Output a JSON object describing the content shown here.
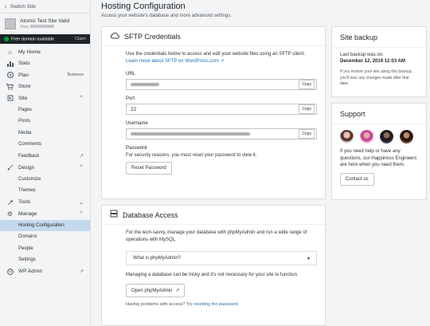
{
  "sidebar": {
    "switch_site": "Switch Site",
    "site_name": "Atomic Test Site Valid",
    "site_view": "View",
    "promo_text": "Free domain available",
    "promo_claim": "Claim",
    "items": {
      "my_home": "My Home",
      "stats": "Stats",
      "plan": "Plan",
      "plan_badge": "Business",
      "store": "Store",
      "site": "Site",
      "pages": "Pages",
      "posts": "Posts",
      "media": "Media",
      "comments": "Comments",
      "feedback": "Feedback",
      "design": "Design",
      "customize": "Customize",
      "themes": "Themes",
      "tools": "Tools",
      "manage": "Manage",
      "hosting": "Hosting Configuration",
      "domains": "Domains",
      "people": "People",
      "settings": "Settings",
      "wp_admin": "WP Admin"
    }
  },
  "header": {
    "title": "Hosting Configuration",
    "subtitle": "Access your website's database and more advanced settings."
  },
  "sftp": {
    "title": "SFTP Credentials",
    "desc_a": "Use the credentials below to access and edit your website files using an SFTP client.",
    "desc_link": "Learn more about SFTP on WordPress.com",
    "url_label": "URL",
    "port_label": "Port",
    "port_value": "22",
    "username_label": "Username",
    "password_label": "Password",
    "password_note": "For security reasons, you must reset your password to view it.",
    "reset_button": "Reset Password",
    "copy": "Copy"
  },
  "db": {
    "title": "Database Access",
    "desc": "For the tech-savvy, manage your database with phpMyAdmin and run a wide range of operations with MySQL.",
    "accordion": "What is phpMyAdmin?",
    "note": "Managing a database can be tricky and it's not necessary for your site to function.",
    "open_button": "Open phpMyAdmin",
    "problems_a": "Having problems with access? Try",
    "problems_link": "resetting the password",
    "problems_b": "."
  },
  "backup": {
    "title": "Site backup",
    "line1": "Last backup was on:",
    "line2": "December 12, 2019 12:03 AM",
    "note": "If you restore your site using this backup, you'll lose any changes made after that date."
  },
  "support": {
    "title": "Support",
    "text": "If you need help or have any questions, our Happiness Engineers are here when you need them.",
    "contact": "Contact us"
  },
  "colors": {
    "active": "#c5d9ed",
    "link": "#2271b1",
    "promo_bg": "#1d2327",
    "promo_dot": "#00a32a"
  }
}
